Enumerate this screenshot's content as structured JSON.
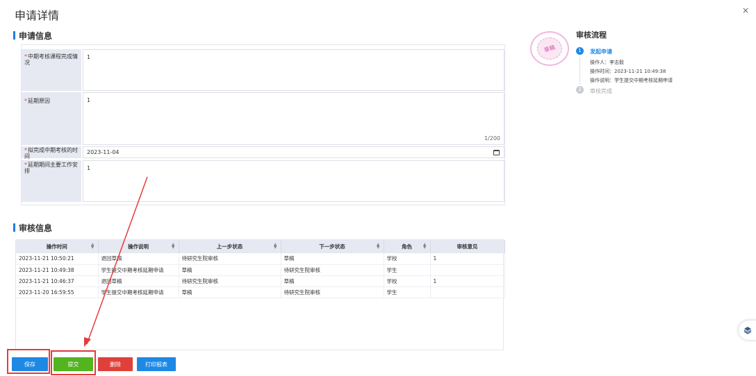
{
  "dialog": {
    "title": "申请详情",
    "close": "×"
  },
  "apply_section": {
    "title": "申请信息"
  },
  "form": {
    "fields": [
      {
        "label": "中期考核课程完成情况",
        "value": "1"
      },
      {
        "label": "延期原因",
        "value": "1",
        "counter": "1/200"
      },
      {
        "label": "拟完成中期考核的时间",
        "value": "2023-11-04"
      },
      {
        "label": "延期期间主要工作安排",
        "value": "1"
      }
    ]
  },
  "flow": {
    "title": "审核流程",
    "stamp": "草稿",
    "steps": [
      {
        "num": "1",
        "title": "发起申请",
        "operator": "操作人：李志毅",
        "time": "操作时间：2023-11-21 10:49:38",
        "desc": "操作说明：学生提交中期考核延期申请"
      },
      {
        "num": "2",
        "title": "审核完成"
      }
    ]
  },
  "review_section": {
    "title": "审核信息"
  },
  "table": {
    "headers": [
      "操作时间",
      "操作说明",
      "上一步状态",
      "下一步状态",
      "角色",
      "审核意见"
    ],
    "rows": [
      [
        "2023-11-21 10:50:21",
        "退回草稿",
        "待研究生院审核",
        "草稿",
        "学校",
        "1"
      ],
      [
        "2023-11-21 10:49:38",
        "学生提交中期考核延期申请",
        "草稿",
        "待研究生院审核",
        "学生",
        ""
      ],
      [
        "2023-11-21 10:46:37",
        "退回草稿",
        "待研究生院审核",
        "草稿",
        "学校",
        "1"
      ],
      [
        "2023-11-20 16:59:55",
        "学生提交中期考核延期申请",
        "草稿",
        "待研究生院审核",
        "学生",
        ""
      ]
    ]
  },
  "buttons": {
    "save": "保存",
    "submit": "提交",
    "delete": "删除",
    "print": "打印报表"
  },
  "colors": {
    "primary": "#1e88e5",
    "success": "#52b41f",
    "danger": "#e0403a",
    "highlight": "#e83a3a"
  },
  "icons": {
    "close": "close-icon",
    "calendar": "calendar-icon",
    "layers": "layers-icon"
  }
}
